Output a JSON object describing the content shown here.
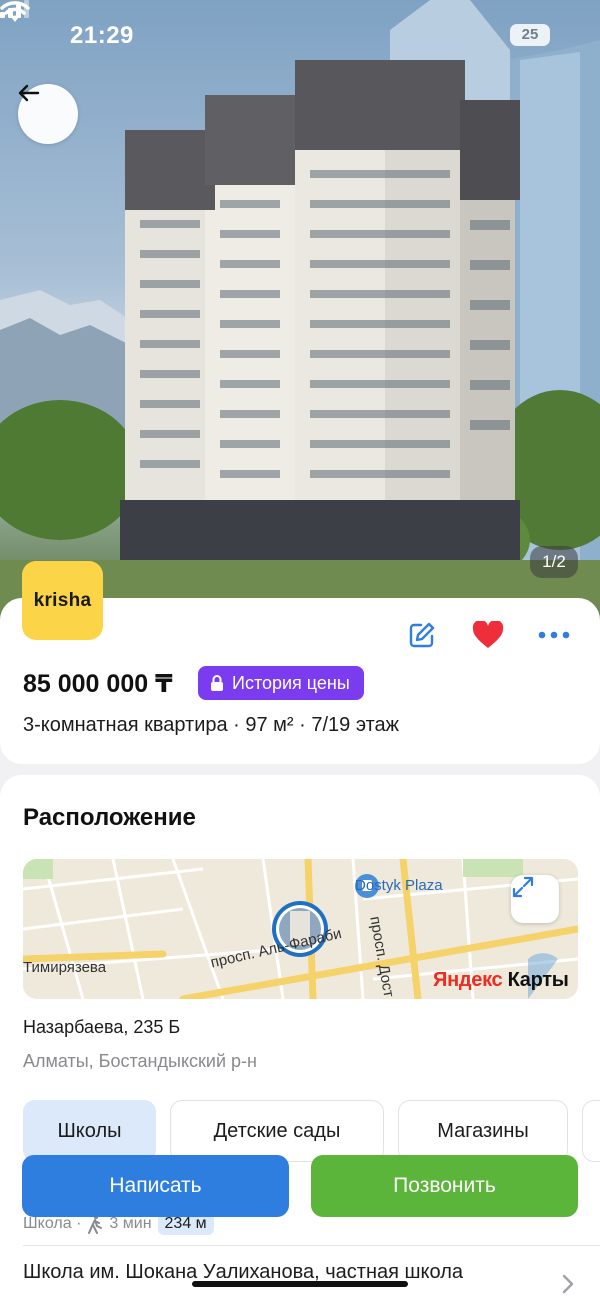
{
  "status_bar": {
    "time": "21:29",
    "battery": "25"
  },
  "gallery": {
    "counter": "1/2"
  },
  "listing": {
    "logo_text": "krisha",
    "price": "85 000 000 ₸",
    "history_label": "История цены",
    "description": "3-комнатная квартира · 97 м² · 7/19 этаж"
  },
  "location": {
    "title": "Расположение",
    "map": {
      "poi": "Dostyk Plaza",
      "street_1": "просп. Аль-Фараби",
      "street_2": "Тимирязева",
      "street_3": "просп. Дост",
      "brand_1": "Яндекс",
      "brand_2": " Карты"
    },
    "address": "Назарбаева, 235 Б",
    "district": "Алматы, Бостандыкский р-н",
    "tabs": [
      "Школы",
      "Детские сады",
      "Магазины"
    ],
    "school_1": {
      "type": "Школа ·",
      "time": "3 мин",
      "distance": "234 м"
    },
    "school_2": {
      "name": "Школа им. Шокана Уалиханова, частная школа"
    }
  },
  "actions": {
    "write": "Написать",
    "call": "Позвонить"
  },
  "colors": {
    "accent_blue": "#2e7ee0",
    "call_green": "#5bb53b",
    "history_purple": "#7b3cf0",
    "logo_yellow": "#fcd447",
    "heart_red": "#ee2e3a"
  }
}
